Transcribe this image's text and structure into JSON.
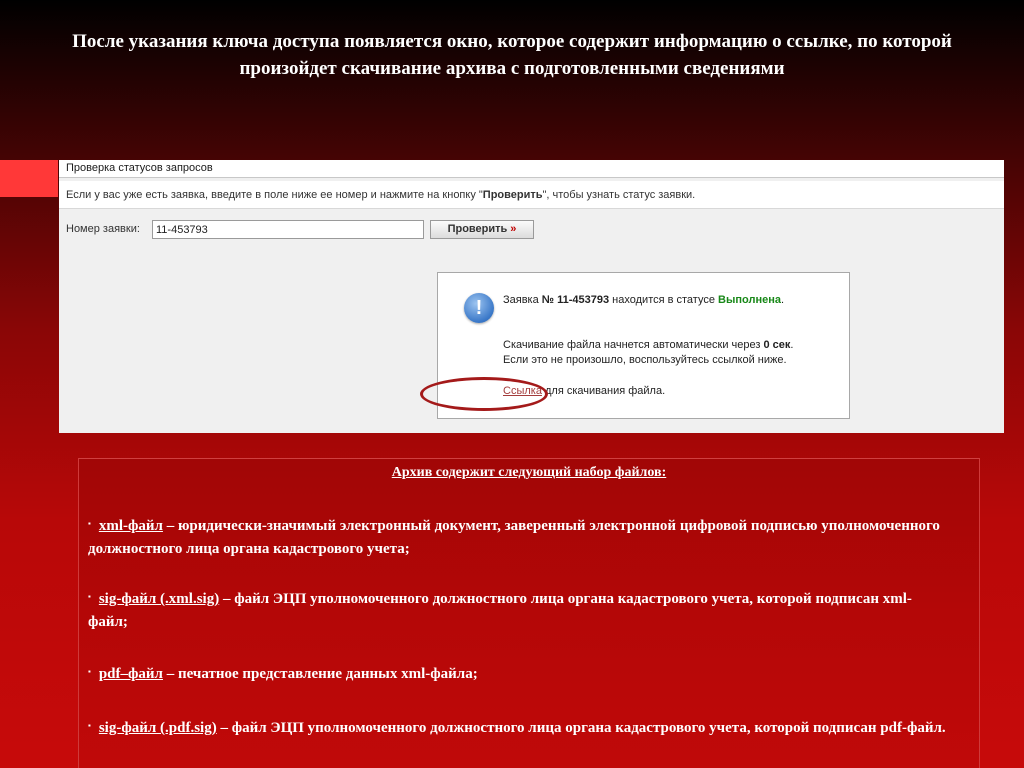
{
  "slide": {
    "title": "После указания ключа доступа появляется окно, которое содержит информацию о ссылке, по которой произойдет скачивание архива с подготовленными сведениями"
  },
  "panel": {
    "title": "Проверка статусов запросов",
    "instruction_before": "Если у вас уже есть заявка, введите в поле ниже ее номер и нажмите на кнопку \"",
    "instruction_button_name": "Проверить",
    "instruction_after": "\", чтобы узнать статус заявки.",
    "request_label": "Номер заявки:",
    "request_value": "11-453793",
    "check_button_label": "Проверить",
    "check_button_arrows": "»"
  },
  "dialog": {
    "icon": "info-exclamation-icon",
    "status_prefix": "Заявка ",
    "status_number": "№ 11-453793",
    "status_middle": " находится в статусе ",
    "status_value": "Выполнена",
    "status_period": ".",
    "download_line1_prefix": "Скачивание файла начнется автоматически через ",
    "download_seconds": "0 сек",
    "download_line1_suffix": ".",
    "download_line2": "Если это не произошло, воспользуйтесь ссылкой ниже.",
    "link_text": "Ссылка",
    "link_suffix": " для скачивания файла."
  },
  "archive": {
    "heading": "Архив содержит следующий набор файлов:",
    "bullet": "▪",
    "items": [
      {
        "name": "xml-файл",
        "description": " – юридически-значимый электронный документ, заверенный электронной цифровой подписью уполномоченного должностного лица органа кадастрового учета;"
      },
      {
        "name": "sig-файл (.xml.sig)",
        "description": " – файл ЭЦП уполномоченного должностного лица органа кадастрового учета, которой подписан xml-файл;"
      },
      {
        "name": "pdf–файл",
        "description": " – печатное представление данных xml-файла;"
      },
      {
        "name": "sig-файл (.pdf.sig)",
        "description": " – файл ЭЦП уполномоченного должностного лица органа кадастрового учета, которой подписан pdf-файл."
      }
    ]
  },
  "colors": {
    "accent_bar": "#ff3838",
    "status_green": "#188818",
    "link_color": "#a33b3b",
    "highlight_ring": "#a41a1a"
  }
}
